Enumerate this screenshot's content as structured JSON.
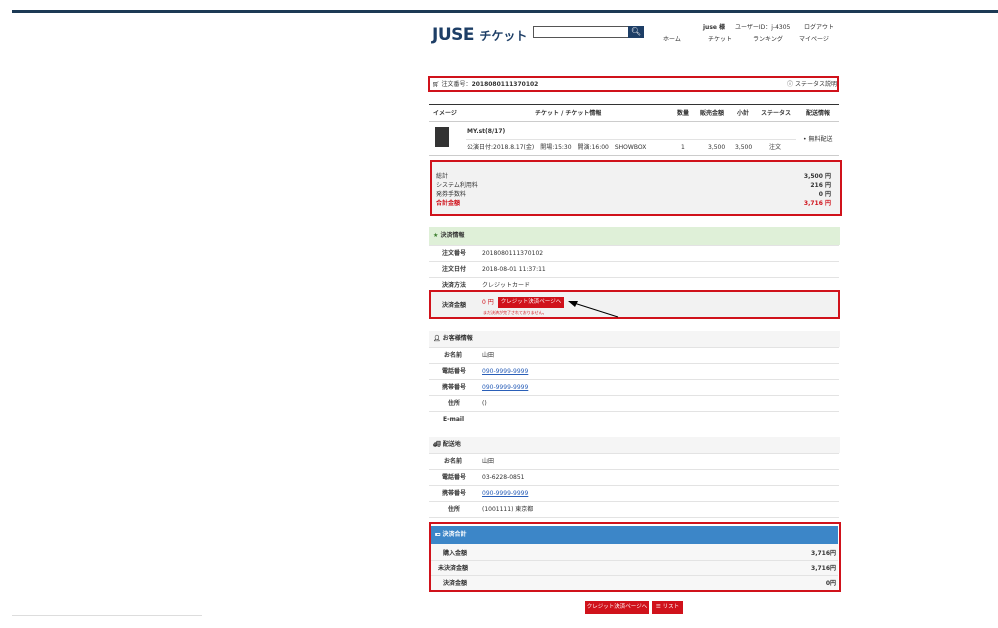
{
  "header": {
    "logo_main": "JUSE",
    "logo_sub": "チケット",
    "user_greeting": "juse 様",
    "user_id": "ユーザーID：j-4305",
    "logout": "ログアウト",
    "nav": [
      "ホーム",
      "チケット",
      "ランキング",
      "マイページ"
    ]
  },
  "order": {
    "label": "注文番号：",
    "number": "2018080111370102",
    "status_link": "ステータス説明"
  },
  "table": {
    "headers": [
      "イメージ",
      "チケット / チケット情報",
      "数量",
      "販売金額",
      "小計",
      "ステータス",
      "配送情報"
    ],
    "item": {
      "title": "MY.st(8/17)",
      "detail": "公演日付:2018.8.17(金)　開場:15:30　開演:16:00　SHOWBOX",
      "qty": "1",
      "price": "3,500",
      "subtotal": "3,500",
      "status": "注文",
      "delivery": "• 無料配送"
    }
  },
  "totals": {
    "rows": [
      {
        "label": "総計",
        "value": "3,500 円"
      },
      {
        "label": "システム利用料",
        "value": "216 円"
      },
      {
        "label": "発券手数料",
        "value": "0 円"
      }
    ],
    "total_label": "合計金額",
    "total_value": "3,716 円"
  },
  "payment": {
    "title": "決済情報",
    "rows": [
      {
        "label": "注文番号",
        "value": "2018080111370102"
      },
      {
        "label": "注文日付",
        "value": "2018-08-01 11:37:11"
      },
      {
        "label": "決済方法",
        "value": "クレジットカード"
      }
    ],
    "amount_label": "決済金額",
    "amount_value": "0 円",
    "pay_button": "クレジット決済ページへ",
    "note": "まだ決済が完了されておりません。"
  },
  "customer": {
    "title": "お客様情報",
    "rows": [
      {
        "label": "お名前",
        "value": "山田"
      },
      {
        "label": "電話番号",
        "value": "090-9999-9999"
      },
      {
        "label": "携帯番号",
        "value": "090-9999-9999"
      },
      {
        "label": "住所",
        "value": "()"
      },
      {
        "label": "E-mail",
        "value": ""
      }
    ]
  },
  "shipping": {
    "title": "配送地",
    "rows": [
      {
        "label": "お名前",
        "value": "山田"
      },
      {
        "label": "電話番号",
        "value": "03-6228-0851"
      },
      {
        "label": "携帯番号",
        "value": "090-9999-9999"
      },
      {
        "label": "住所",
        "value": "(1001111) 東京都"
      }
    ]
  },
  "summary": {
    "title": "決済合計",
    "rows": [
      {
        "label": "購入金額",
        "value": "3,716円"
      },
      {
        "label": "未決済金額",
        "value": "3,716円"
      },
      {
        "label": "決済金額",
        "value": "0円"
      }
    ]
  },
  "buttons": {
    "pay": "クレジット決済ページへ",
    "list": "リスト"
  },
  "colors": {
    "accent": "#d0121b",
    "brand": "#1d3e66",
    "payment_header": "#dff0d8",
    "summary_header": "#3c86c8"
  }
}
